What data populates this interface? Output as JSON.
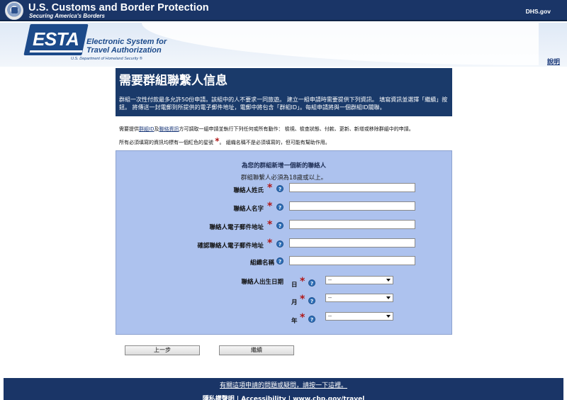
{
  "banner": {
    "agency": "U.S. Customs and Border Protection",
    "tagline": "Securing America's Borders",
    "dhs_link": "DHS.gov"
  },
  "esta": {
    "logo": "ESTA",
    "line1": "Electronic System for",
    "line2": "Travel Authorization",
    "line3": "U.S. Department of Homeland Security ®"
  },
  "help_link": "說明",
  "page": {
    "title": "需要群組聯繫人信息",
    "intro": "群組一次性付款最多允許50份申請。該組中的人不要求一同旅遊。 建立一組申請時需要提供下列資訊。 填寫資訊並選擇「繼續」按鈕。 將傳送一封電郵到所提供的電子郵件地址，電郵中將包含「群組ID」。每組申請將與一個群組ID關聯。"
  },
  "info": {
    "prefix": "需要提供",
    "link_group_id": "群組ID",
    "and": "及",
    "link_contact_info": "聯絡資訊",
    "suffix": "方可調取一組申請並執行下列任何或所有動作： 檢視、檢查狀態、付款、更新、新增或移除群組中的申請。",
    "required_prefix": "所有必須填寫的資訊均標有一個紅色的星號",
    "star_symbol": "*",
    "required_suffix": "。 組織名稱不是必須填寫的，但可能有幫助作用。"
  },
  "form": {
    "title": "為您的群組新增一個新的聯絡人",
    "subtitle": "群組聯繫人必須為18歲或以上。",
    "fields": {
      "surname": {
        "label": "聯絡人姓氏",
        "value": ""
      },
      "given_name": {
        "label": "聯絡人名字",
        "value": ""
      },
      "email": {
        "label": "聯絡人電子郵件地址",
        "value": ""
      },
      "email_confirm": {
        "label": "確認聯絡人電子郵件地址",
        "value": ""
      },
      "organization": {
        "label": "組織名稱",
        "value": ""
      }
    },
    "dob": {
      "label": "聯絡人出生日期",
      "day_label": "日",
      "month_label": "月",
      "year_label": "年",
      "day_value": "--",
      "month_value": "--",
      "year_value": "--"
    },
    "help_glyph": "?",
    "star": "*"
  },
  "buttons": {
    "back": "上一步",
    "continue": "繼續"
  },
  "footer": {
    "question_link": "有關這項申請的問題或疑問，請按一下這裡。",
    "links": "隱私權聲明 | Accessibility | www.cbp.gov/travel"
  },
  "colors": {
    "navy": "#1a3567",
    "panel": "#adc2ee",
    "required": "#b01818"
  }
}
